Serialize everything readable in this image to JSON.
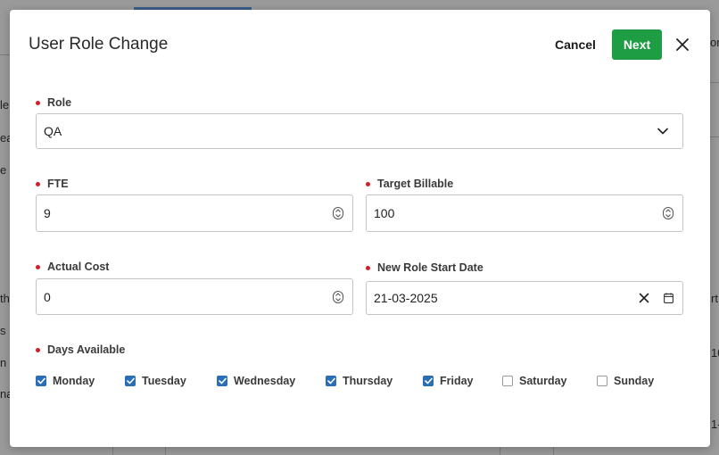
{
  "background": {
    "fragments": [
      "le",
      "ea",
      "e",
      "th",
      "s",
      "n",
      "na",
      "on",
      "rt",
      "10",
      "1-"
    ]
  },
  "modal": {
    "title": "User Role Change",
    "cancel_label": "Cancel",
    "next_label": "Next"
  },
  "form": {
    "role": {
      "label": "Role",
      "value": "QA"
    },
    "fte": {
      "label": "FTE",
      "value": "9"
    },
    "target_billable": {
      "label": "Target Billable",
      "value": "100"
    },
    "actual_cost": {
      "label": "Actual Cost",
      "value": "0"
    },
    "new_role_start_date": {
      "label": "New Role Start Date",
      "value": "21-03-2025"
    },
    "days_available": {
      "label": "Days Available",
      "days": [
        {
          "name": "Monday",
          "checked": true
        },
        {
          "name": "Tuesday",
          "checked": true
        },
        {
          "name": "Wednesday",
          "checked": true
        },
        {
          "name": "Thursday",
          "checked": true
        },
        {
          "name": "Friday",
          "checked": true
        },
        {
          "name": "Saturday",
          "checked": false
        },
        {
          "name": "Sunday",
          "checked": false
        }
      ]
    }
  },
  "colors": {
    "primary_button": "#1f9d45",
    "required_marker": "#d0202a",
    "checkbox_checked": "#2a6fb5"
  }
}
